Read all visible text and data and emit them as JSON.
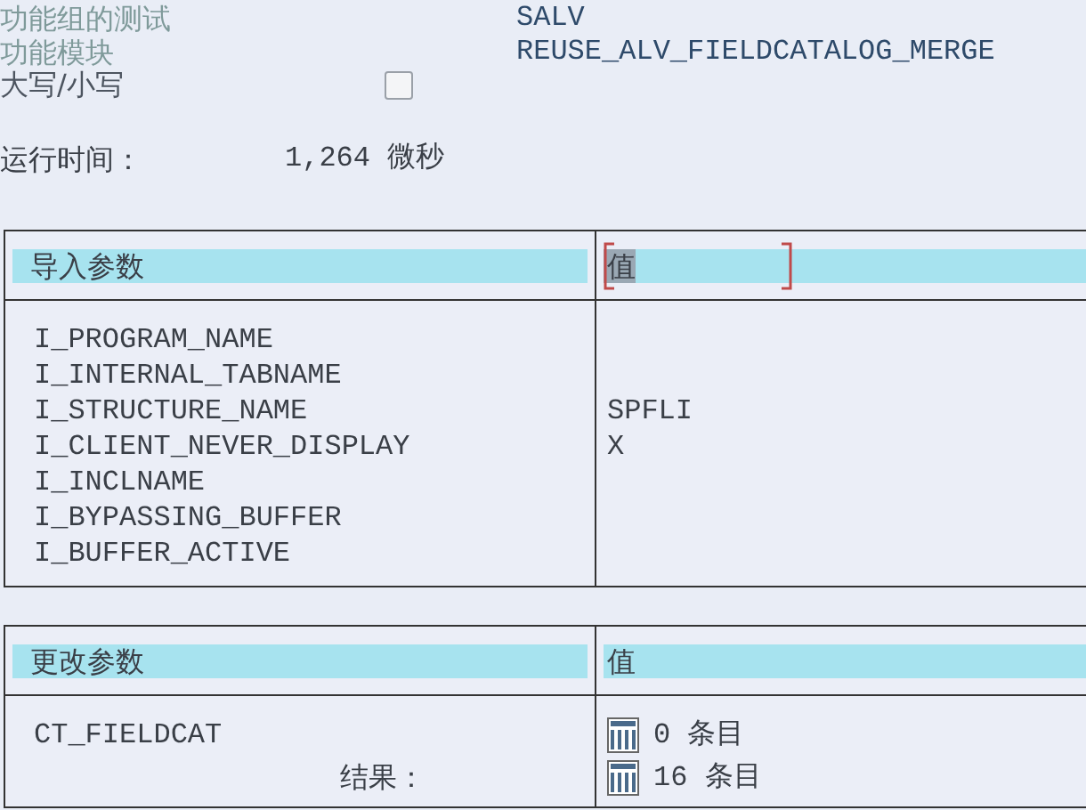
{
  "header": {
    "fields": [
      {
        "label": "功能组的测试",
        "value": "SALV"
      },
      {
        "label": "功能模块",
        "value": "REUSE_ALV_FIELDCATALOG_MERGE"
      }
    ],
    "case_option": {
      "label": "大写/小写",
      "checked": false
    },
    "runtime": {
      "label": "运行时间：",
      "value": "1,264 微秒"
    }
  },
  "import_table": {
    "columns": [
      {
        "label": "导入参数",
        "focused": false
      },
      {
        "label": "值",
        "focused": true
      }
    ],
    "rows": [
      {
        "name": "I_PROGRAM_NAME"
      },
      {
        "name": "I_INTERNAL_TABNAME"
      },
      {
        "name": "I_STRUCTURE_NAME",
        "value": "SPFLI"
      },
      {
        "name": "I_CLIENT_NEVER_DISPLAY",
        "value": "X"
      },
      {
        "name": "I_INCLNAME"
      },
      {
        "name": "I_BYPASSING_BUFFER"
      },
      {
        "name": "I_BUFFER_ACTIVE"
      }
    ]
  },
  "changing_table": {
    "columns": [
      {
        "label": "更改参数",
        "focused": false
      },
      {
        "label": "值",
        "focused": false
      }
    ],
    "rows": [
      {
        "kind": "parameter",
        "name": "CT_FIELDCAT",
        "value": "0 条目"
      },
      {
        "kind": "result",
        "name": "结果：",
        "value": "16 条目"
      }
    ]
  }
}
